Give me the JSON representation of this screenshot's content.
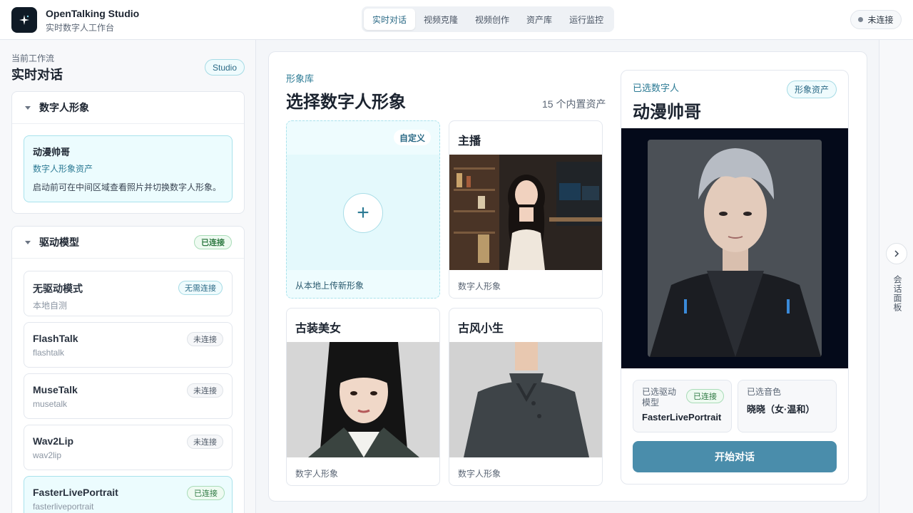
{
  "header": {
    "app_name": "OpenTalking Studio",
    "app_sub": "实时数字人工作台",
    "tabs": [
      {
        "label": "实时对话",
        "active": true
      },
      {
        "label": "视频克隆",
        "active": false
      },
      {
        "label": "视频创作",
        "active": false
      },
      {
        "label": "资产库",
        "active": false
      },
      {
        "label": "运行监控",
        "active": false
      }
    ],
    "connection_status": "未连接"
  },
  "sidebar": {
    "workflow_label": "当前工作流",
    "workflow_title": "实时对话",
    "studio_badge": "Studio",
    "avatar_section": {
      "title": "数字人形象",
      "selected_name": "动漫帅哥",
      "selected_type": "数字人形象资产",
      "hint": "启动前可在中间区域查看照片并切换数字人形象。"
    },
    "model_section": {
      "title": "驱动模型",
      "status": "已连接",
      "models": [
        {
          "name": "无驱动模式",
          "id": "本地自测",
          "status": "无需连接"
        },
        {
          "name": "FlashTalk",
          "id": "flashtalk",
          "status": "未连接"
        },
        {
          "name": "MuseTalk",
          "id": "musetalk",
          "status": "未连接"
        },
        {
          "name": "Wav2Lip",
          "id": "wav2lip",
          "status": "未连接"
        },
        {
          "name": "FasterLivePortrait",
          "id": "fasterliveportrait",
          "status": "已连接"
        }
      ]
    }
  },
  "library": {
    "label": "形象库",
    "title": "选择数字人形象",
    "count": "15 个内置资产",
    "upload": {
      "tag": "自定义",
      "caption": "从本地上传新形象"
    },
    "tiles": [
      {
        "name": "主播",
        "type": "数字人形象"
      },
      {
        "name": "古装美女",
        "type": "数字人形象"
      },
      {
        "name": "古风小生",
        "type": "数字人形象"
      }
    ]
  },
  "selected": {
    "label": "已选数字人",
    "name": "动漫帅哥",
    "badge": "形象资产",
    "model_label": "已选驱动模型",
    "model_status": "已连接",
    "model_value": "FasterLivePortrait",
    "voice_label": "已选音色",
    "voice_value": "晓晓（女·温和）",
    "start_button": "开始对话"
  },
  "rail": {
    "label": "会话面板"
  },
  "colors": {
    "accent": "#4a8dab",
    "accent_text": "#2b7a94",
    "connected_green": "#2f7a43",
    "selected_bg": "#ecfcfe"
  }
}
